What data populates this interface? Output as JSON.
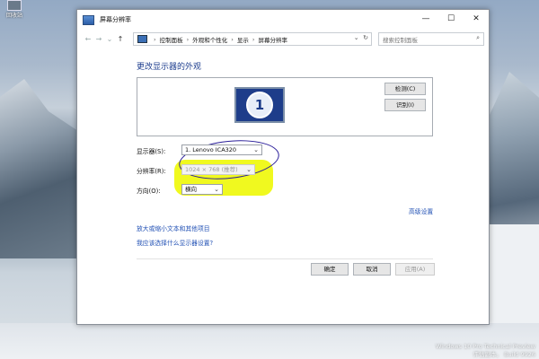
{
  "desktop": {
    "icon_label": "回收站",
    "watermark_line1": "Windows 10 Pro Technical Preview",
    "watermark_line2": "评估副本。 Build 9926"
  },
  "window": {
    "title": "屏幕分辨率",
    "controls": {
      "minimize": "—",
      "maximize": "☐",
      "close": "✕"
    }
  },
  "nav": {
    "back": "←",
    "forward": "→",
    "recent": "⌄",
    "up": "↑",
    "breadcrumb": [
      "控制面板",
      "外观和个性化",
      "显示",
      "屏幕分辨率"
    ],
    "separator": "›",
    "dropdown": "⌄",
    "refresh": "↻",
    "search_placeholder": "搜索控制面板",
    "search_icon": "⌕"
  },
  "main": {
    "heading": "更改显示器的外观",
    "monitor_number": "1",
    "detect_button": "检测(C)",
    "identify_button": "识别(I)",
    "display_label": "显示器(S):",
    "display_value": "1. Lenovo ICA320",
    "resolution_label": "分辨率(R):",
    "resolution_value": "1024 × 768 (推荐)",
    "orientation_label": "方向(O):",
    "orientation_value": "横向",
    "dropdown_arrow": "⌄",
    "advanced_link": "高级设置",
    "link_text_size": "放大或缩小文本和其他项目",
    "link_what_settings": "我应该选择什么显示器设置?"
  },
  "footer": {
    "ok": "确定",
    "cancel": "取消",
    "apply": "应用(A)"
  },
  "colors": {
    "accent_link": "#2352b5",
    "heading": "#1f3f8f",
    "highlight": "#eef800"
  }
}
